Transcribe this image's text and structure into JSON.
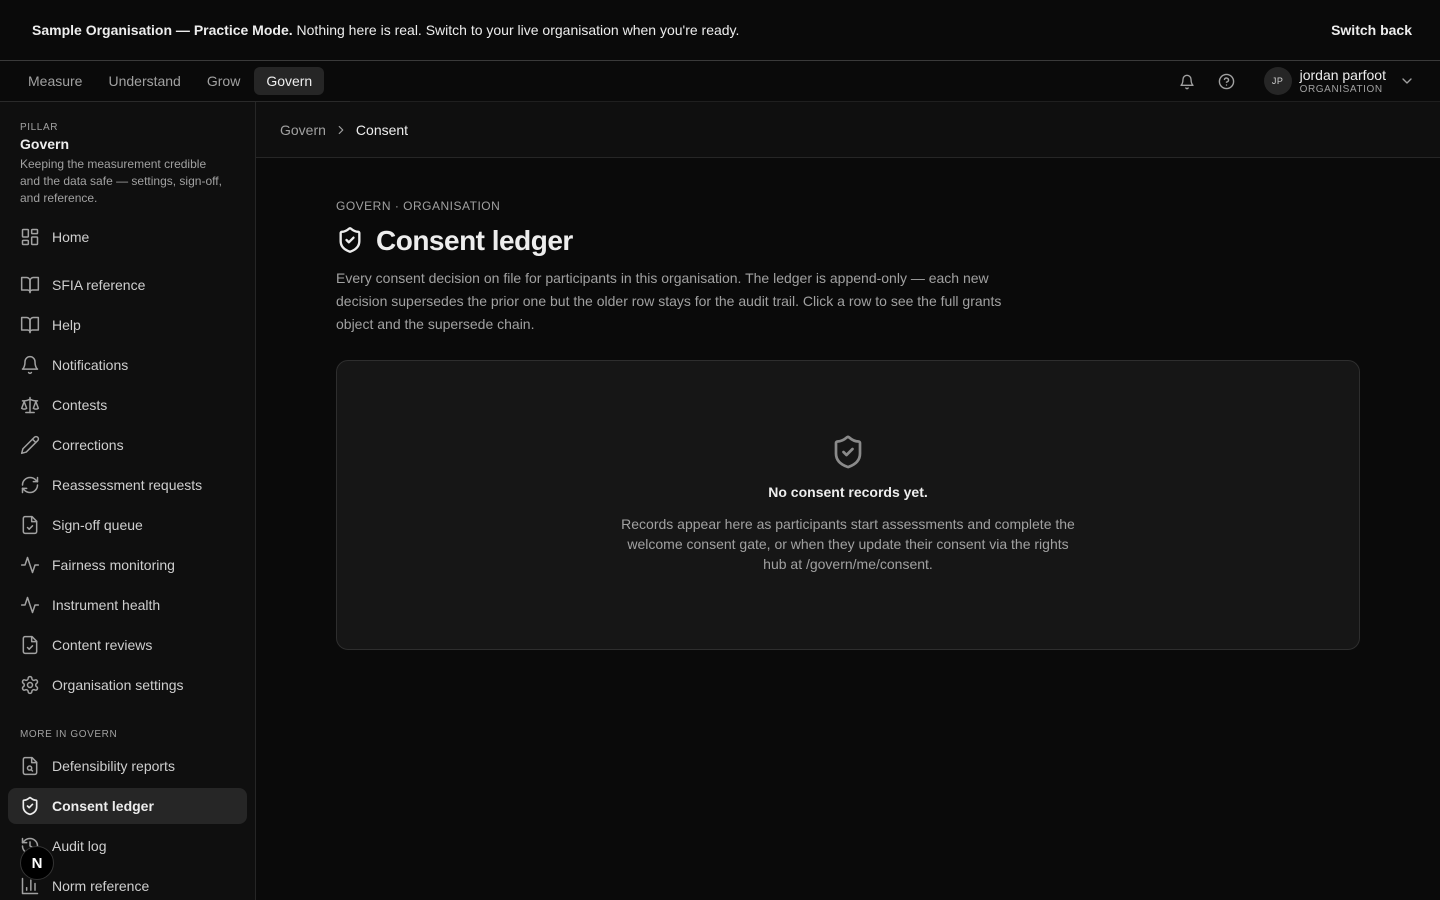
{
  "banner": {
    "lead": "Sample Organisation — Practice Mode.",
    "message": "Nothing here is real. Switch to your live organisation when you're ready.",
    "action": "Switch back"
  },
  "topnav": {
    "tabs": [
      {
        "label": "Measure"
      },
      {
        "label": "Understand"
      },
      {
        "label": "Grow"
      },
      {
        "label": "Govern",
        "active": true
      }
    ],
    "user": {
      "initials": "JP",
      "name": "jordan parfoot",
      "role": "ORGANISATION"
    },
    "icons": [
      "bell-icon",
      "help-circle-icon",
      "chevron-down-icon"
    ]
  },
  "sidebar": {
    "pillar_label": "PILLAR",
    "pillar_title": "Govern",
    "pillar_desc": "Keeping the measurement credible and the data safe — settings, sign-off, and reference.",
    "items": [
      {
        "label": "Home",
        "icon": "grid-icon"
      },
      {
        "label": "SFIA reference",
        "icon": "book-icon"
      },
      {
        "label": "Help",
        "icon": "book-icon"
      },
      {
        "label": "Notifications",
        "icon": "bell-icon"
      },
      {
        "label": "Contests",
        "icon": "scale-icon"
      },
      {
        "label": "Corrections",
        "icon": "pencil-icon"
      },
      {
        "label": "Reassessment requests",
        "icon": "refresh-icon"
      },
      {
        "label": "Sign-off queue",
        "icon": "file-check-icon"
      },
      {
        "label": "Fairness monitoring",
        "icon": "activity-icon"
      },
      {
        "label": "Instrument health",
        "icon": "activity-icon"
      },
      {
        "label": "Content reviews",
        "icon": "file-check-icon"
      },
      {
        "label": "Organisation settings",
        "icon": "gear-icon"
      }
    ],
    "more_label": "MORE IN GOVERN",
    "more_items": [
      {
        "label": "Defensibility reports",
        "icon": "file-search-icon"
      },
      {
        "label": "Consent ledger",
        "icon": "shield-check-icon",
        "active": true
      },
      {
        "label": "Audit log",
        "icon": "history-icon"
      },
      {
        "label": "Norm reference",
        "icon": "bar-chart-icon"
      }
    ],
    "fab_label": "N"
  },
  "breadcrumb": {
    "parent": "Govern",
    "current": "Consent"
  },
  "main": {
    "eyebrow": "GOVERN · ORGANISATION",
    "title": "Consent ledger",
    "lede": "Every consent decision on file for participants in this organisation. The ledger is append-only — each new decision supersedes the prior one but the older row stays for the audit trail. Click a row to see the full grants object and the supersede chain.",
    "empty": {
      "title": "No consent records yet.",
      "desc": "Records appear here as participants start assessments and complete the welcome consent gate, or when they update their consent via the rights hub at /govern/me/consent."
    }
  }
}
